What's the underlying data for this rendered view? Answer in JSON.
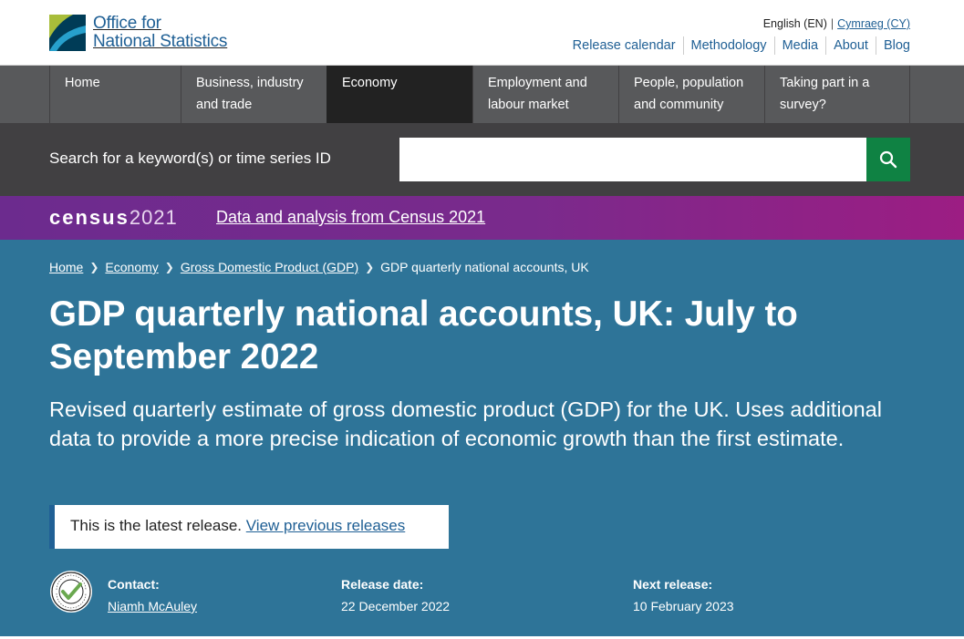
{
  "header": {
    "logo_line1": "Office for",
    "logo_line2": "National Statistics",
    "lang_current": "English (EN)",
    "lang_separator": "|",
    "lang_alternate": "Cymraeg (CY)",
    "secondary_nav": [
      "Release calendar",
      "Methodology",
      "Media",
      "About",
      "Blog"
    ]
  },
  "primary_nav": [
    {
      "label": "Home"
    },
    {
      "label": "Business, industry and trade"
    },
    {
      "label": "Economy",
      "active": true
    },
    {
      "label": "Employment and labour market"
    },
    {
      "label": "People, population and community"
    },
    {
      "label": "Taking part in a survey?"
    }
  ],
  "search": {
    "label": "Search for a keyword(s) or time series ID",
    "value": "",
    "button_icon": "search-icon"
  },
  "census_banner": {
    "logo_word": "census",
    "logo_year": "2021",
    "link_text": "Data and analysis from Census 2021"
  },
  "breadcrumb": [
    "Home",
    "Economy",
    "Gross Domestic Product (GDP)",
    "GDP quarterly national accounts, UK"
  ],
  "page": {
    "title": "GDP quarterly national accounts, UK: July to September 2022",
    "description": "Revised quarterly estimate of gross domestic product (GDP) for the UK. Uses additional data to provide a more precise indication of economic growth than the first estimate.",
    "latest_text": "This is the latest release.",
    "latest_link": "View previous releases"
  },
  "meta": {
    "badge_icon": "national-statistics-badge-icon",
    "contact_label": "Contact:",
    "contact_value": "Niamh McAuley",
    "release_label": "Release date:",
    "release_value": "22 December 2022",
    "next_label": "Next release:",
    "next_value": "10 February 2023"
  },
  "colors": {
    "brand_blue": "#206095",
    "hero_blue": "#2e7498",
    "nav_grey": "#58595b",
    "search_grey": "#414042",
    "search_button_green": "#0f8243",
    "census_purple": "#6c2b8e"
  }
}
